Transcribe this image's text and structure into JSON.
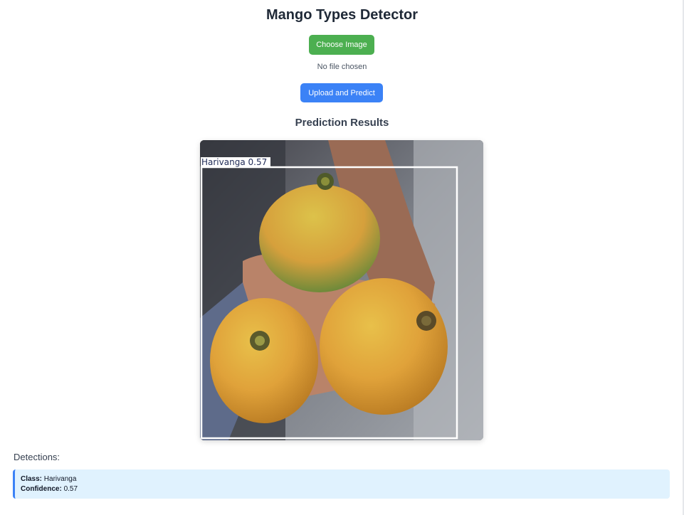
{
  "page": {
    "title": "Mango Types Detector"
  },
  "upload": {
    "choose_label": "Choose Image",
    "file_status": "No file chosen",
    "submit_label": "Upload and Predict"
  },
  "results": {
    "heading": "Prediction Results",
    "overlay_label": "Harivanga  0.57",
    "detections_label": "Detections:",
    "detections": [
      {
        "class_label": "Class:",
        "class_value": "Harivanga",
        "confidence_label": "Confidence:",
        "confidence_value": "0.57"
      }
    ]
  },
  "colors": {
    "choose_button": "#4caf50",
    "upload_button": "#3b82f6",
    "detection_card_bg": "#e0f2fe",
    "detection_card_border": "#3b82f6"
  }
}
